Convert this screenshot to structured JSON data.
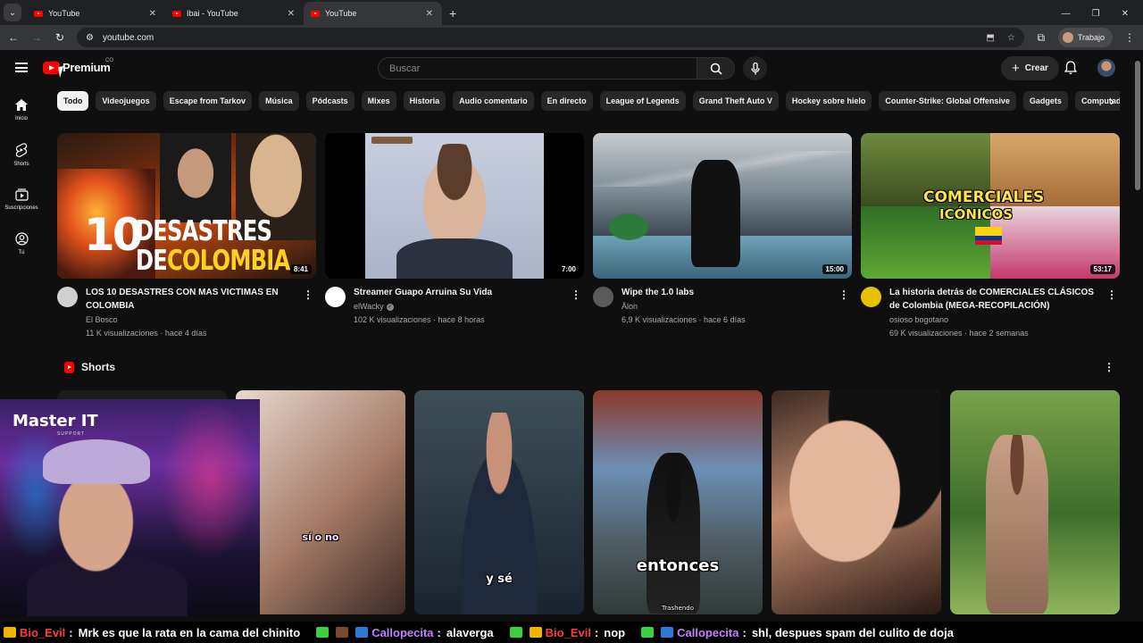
{
  "browser": {
    "tabs": [
      {
        "title": "YouTube",
        "active": false
      },
      {
        "title": "Ibai - YouTube",
        "active": false
      },
      {
        "title": "YouTube",
        "active": true
      }
    ],
    "url": "youtube.com",
    "profile_label": "Trabajo"
  },
  "masthead": {
    "logo_text": "Premium",
    "country_code": "CO",
    "search_placeholder": "Buscar",
    "create_label": "Crear"
  },
  "sidenav": [
    {
      "label": "Inicio",
      "icon": "home-icon"
    },
    {
      "label": "Shorts",
      "icon": "shorts-icon"
    },
    {
      "label": "Suscripciones",
      "icon": "subscriptions-icon"
    },
    {
      "label": "Tú",
      "icon": "you-icon"
    }
  ],
  "chips": [
    "Todo",
    "Videojuegos",
    "Escape from Tarkov",
    "Música",
    "Pódcasts",
    "Mixes",
    "Historia",
    "Audio comentario",
    "En directo",
    "League of Legends",
    "Grand Theft Auto V",
    "Hockey sobre hielo",
    "Counter-Strike: Global Offensive",
    "Gadgets",
    "Computadoras"
  ],
  "videos": [
    {
      "title": "LOS 10 DESASTRES CON MAS VICTIMAS EN COLOMBIA",
      "channel": "El Bosco",
      "stats": "11 K visualizaciones · hace 4 días",
      "duration": "8:41",
      "thumb_text": [
        "10",
        "DESASTRES",
        "DE",
        "COLOMBIA"
      ],
      "avatar_color": "#d0d0d0"
    },
    {
      "title": "Streamer Guapo Arruina Su Vida",
      "channel": "elWacky",
      "verified": true,
      "stats": "102 K visualizaciones · hace 8 horas",
      "duration": "7:00",
      "avatar_color": "#ffffff"
    },
    {
      "title": "Wipe the 1.0 labs",
      "channel": "Ālon",
      "stats": "6,9 K visualizaciones · hace 6 días",
      "duration": "15:00",
      "avatar_color": "#5a5a5a"
    },
    {
      "title": "La historia detrás de COMERCIALES CLÁSICOS de Colombia  (MEGA-RECOPILACIÓN)",
      "channel": "osioso bogotano",
      "stats": "69 K visualizaciones · hace 2 semanas",
      "duration": "53:17",
      "thumb_text": [
        "COMERCIALES",
        "ICÓNICOS"
      ],
      "avatar_color": "#e6c200"
    }
  ],
  "shorts": {
    "heading": "Shorts",
    "captions": [
      "",
      "sí o no",
      "y sé",
      "entonces",
      "",
      ""
    ],
    "watermark": "Trashendo"
  },
  "overlay": {
    "brand": "Master IT",
    "brand_sub": "SUPPORT"
  },
  "chat": [
    {
      "user": "Bio_Evil",
      "color": "#ff3b3b",
      "msg": "Mrk es que la rata en la cama del chinito"
    },
    {
      "user": "Callopecita",
      "color": "#c77dff",
      "msg": "alaverga"
    },
    {
      "user": "Bio_Evil",
      "color": "#ff3b3b",
      "msg": "nop"
    },
    {
      "user": "Callopecita",
      "color": "#c77dff",
      "msg": "shl, despues spam del culito de doja"
    }
  ],
  "colors": {
    "brand_red": "#ff0000",
    "background": "#0f0f0f",
    "chip_bg": "#272727"
  }
}
